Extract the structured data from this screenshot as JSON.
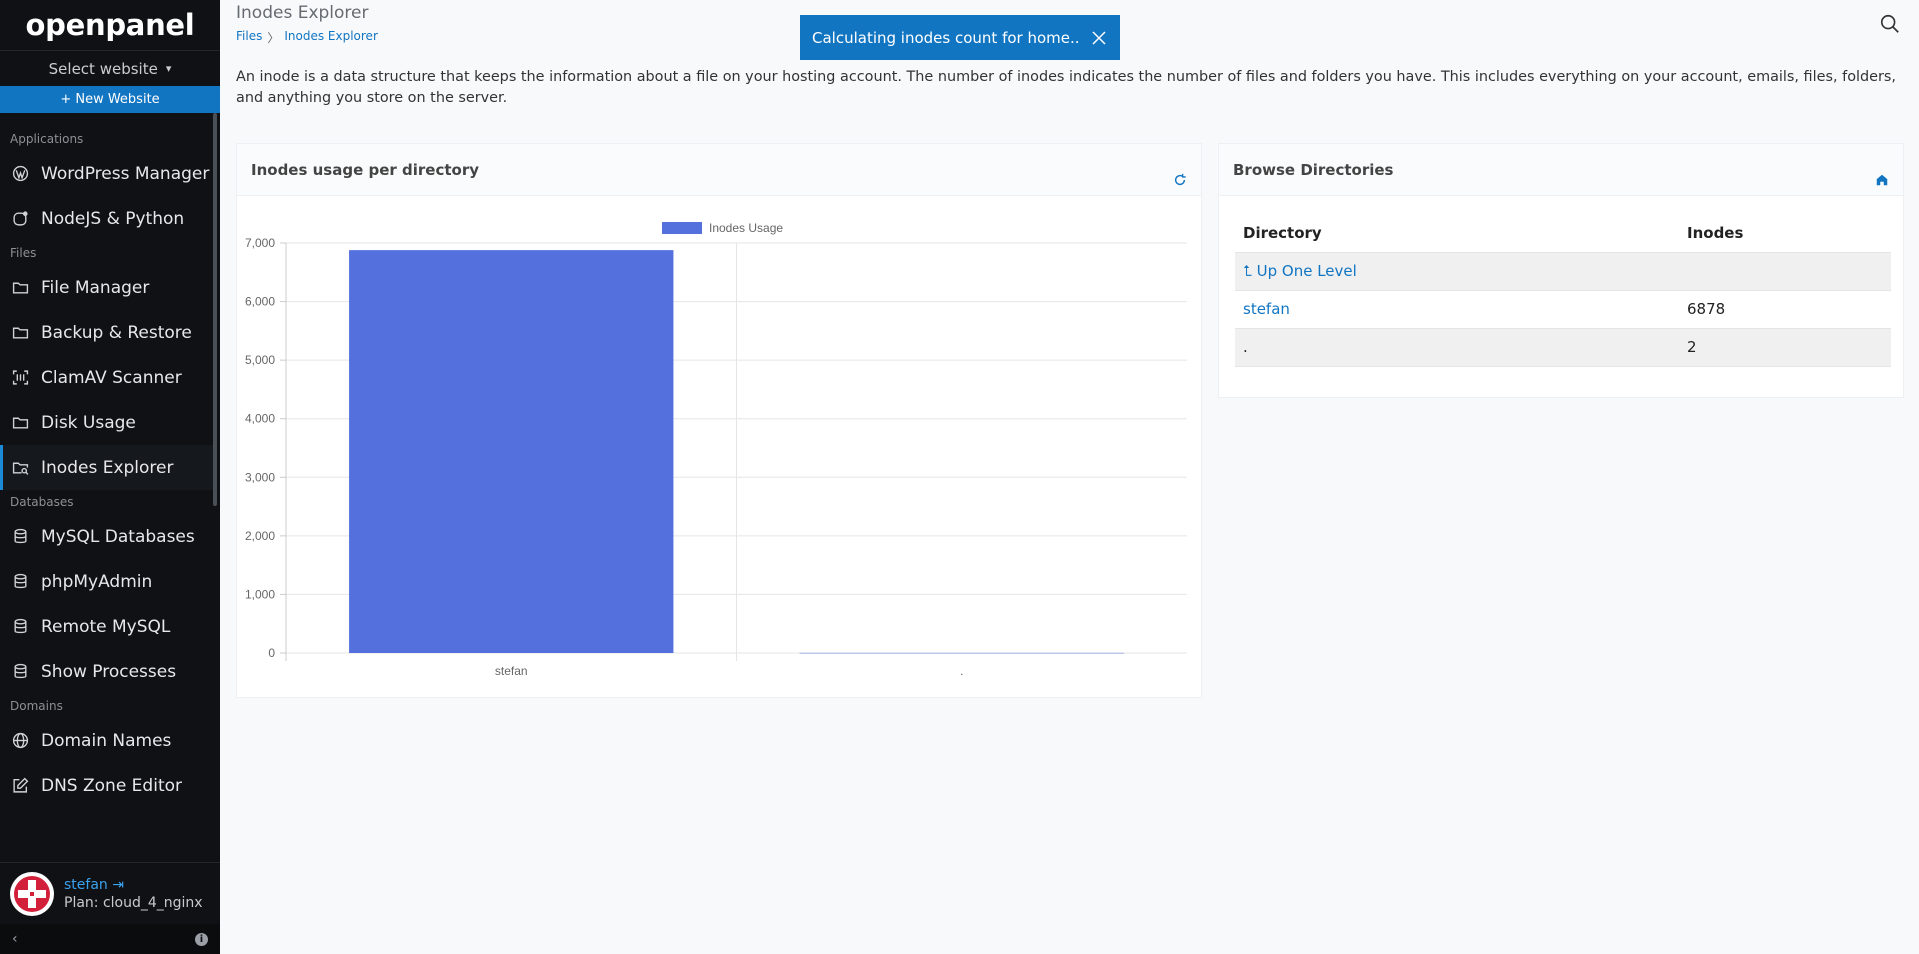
{
  "app": {
    "logo": "openpanel"
  },
  "sidebar": {
    "site_select": "Select website",
    "new_website": "+ New Website",
    "sections": [
      {
        "label": "Applications",
        "items": [
          {
            "label": "WordPress Manager",
            "icon": "wordpress-icon"
          },
          {
            "label": "NodeJS & Python",
            "icon": "nodejs-icon"
          }
        ]
      },
      {
        "label": "Files",
        "items": [
          {
            "label": "File Manager",
            "icon": "folder-icon"
          },
          {
            "label": "Backup & Restore",
            "icon": "folder-backup-icon"
          },
          {
            "label": "ClamAV Scanner",
            "icon": "scanner-icon"
          },
          {
            "label": "Disk Usage",
            "icon": "folder-disk-icon"
          },
          {
            "label": "Inodes Explorer",
            "icon": "folder-search-icon",
            "active": true
          }
        ]
      },
      {
        "label": "Databases",
        "items": [
          {
            "label": "MySQL Databases",
            "icon": "database-icon"
          },
          {
            "label": "phpMyAdmin",
            "icon": "database-admin-icon"
          },
          {
            "label": "Remote MySQL",
            "icon": "database-remote-icon"
          },
          {
            "label": "Show Processes",
            "icon": "database-process-icon"
          }
        ]
      },
      {
        "label": "Domains",
        "items": [
          {
            "label": "Domain Names",
            "icon": "globe-icon"
          },
          {
            "label": "DNS Zone Editor",
            "icon": "edit-icon"
          }
        ]
      }
    ],
    "user": {
      "name": "stefan",
      "plan": "Plan: cloud_4_nginx"
    }
  },
  "header": {
    "title": "Inodes Explorer",
    "breadcrumb": [
      "Files",
      "Inodes Explorer"
    ]
  },
  "toast": {
    "message": "Calculating inodes count for home.."
  },
  "description": "An inode is a data structure that keeps the information about a file on your hosting account. The number of inodes indicates the number of files and folders you have. This includes everything on your account, emails, files, folders, and anything you store on the server.",
  "chart_card": {
    "title": "Inodes usage per directory"
  },
  "chart_data": {
    "type": "bar",
    "categories": [
      "stefan",
      "."
    ],
    "series": [
      {
        "name": "Inodes Usage",
        "values": [
          6878,
          2
        ],
        "color": "#5470dc"
      }
    ],
    "ylim": [
      0,
      7000
    ],
    "yticks": [
      "0",
      "1,000",
      "2,000",
      "3,000",
      "4,000",
      "5,000",
      "6,000",
      "7,000"
    ],
    "legend": "top-center",
    "grid": true
  },
  "dir_card": {
    "title": "Browse Directories",
    "columns": [
      "Directory",
      "Inodes"
    ],
    "up_level": "Up One Level",
    "rows": [
      {
        "directory": "stefan",
        "inodes": "6878"
      },
      {
        "directory": ".",
        "inodes": "2"
      }
    ]
  }
}
